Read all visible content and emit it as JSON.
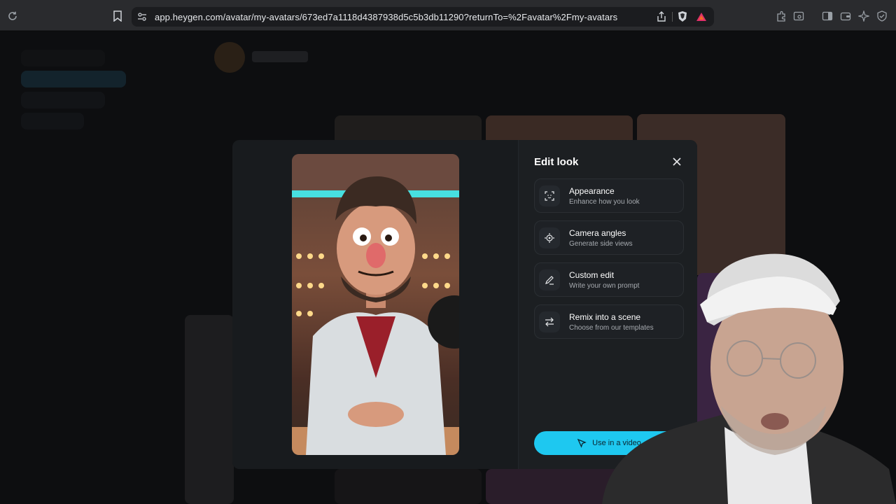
{
  "browser": {
    "url": "app.heygen.com/avatar/my-avatars/673ed7a1118d4387938d5c5b3db11290?returnTo=%2Favatar%2Fmy-avatars"
  },
  "modal": {
    "title": "Edit look",
    "options": [
      {
        "title": "Appearance",
        "subtitle": "Enhance how you look",
        "icon": "scan-face-icon"
      },
      {
        "title": "Camera angles",
        "subtitle": "Generate side views",
        "icon": "camera-angle-icon"
      },
      {
        "title": "Custom edit",
        "subtitle": "Write your own prompt",
        "icon": "pen-edit-icon"
      },
      {
        "title": "Remix into a scene",
        "subtitle": "Choose from our templates",
        "icon": "swap-arrows-icon"
      }
    ],
    "primary_button": "Use in a video",
    "accent_color": "#1ec8f0"
  }
}
